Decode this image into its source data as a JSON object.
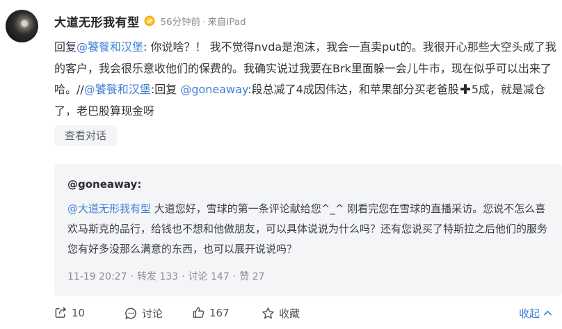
{
  "post": {
    "author": "大道无形我有型",
    "time": "56分钟前",
    "source": "来自iPad",
    "body": {
      "reply_prefix": "回复",
      "mention1": "@饕餮和汉堡",
      "seg1": ": 你说啥？！ 我不觉得nvda是泡沫，我会一直卖put的。我很开心那些大空头成了我的客户，我会很乐意收他们的保费的。我确实说过我要在Brk里面躲一会儿牛市，现在似乎可以出来了哈。//",
      "mention2": "@饕餮和汉堡",
      "seg2": ":回复",
      "mention3": "@goneaway",
      "seg3": ":段总减了4成因伟达，和苹果部分买老爸股",
      "seg4": "5成，就是减仓了，老巴股算现金呀"
    },
    "view_conversation": "查看对话"
  },
  "quoted": {
    "author": "@goneaway",
    "author_suffix": ":",
    "mention": "@大道无形我有型",
    "text": " 大道您好，雪球的第一条评论献给您^_^ 刚看完您在雪球的直播采访。您说不怎么喜欢马斯克的品行，给钱也不想和他做朋友，可以具体说说为什么吗？还有您说买了特斯拉之后他们的服务您有好多没那么满意的东西，也可以展开说说吗？",
    "date": "11-19 20:27",
    "reposts_label": "转发 133",
    "comments_label": "讨论 147",
    "likes_label": "赞 27"
  },
  "actions": {
    "repost_count": "10",
    "comment_label": "讨论",
    "like_count": "167",
    "favorite_label": "收藏",
    "collapse_label": "收起"
  },
  "icons": {
    "verified": "verified-badge-icon",
    "plus": "heavy-plus-emoji-icon",
    "repost": "share-arrow-icon",
    "comment": "chat-bubble-icon",
    "like": "thumbs-up-icon",
    "favorite": "star-icon",
    "collapse": "chevron-up-icon"
  },
  "colors": {
    "link": "#3e7fd6",
    "meta": "#8a8d94",
    "quote_bg": "#f4f5f7",
    "badge": "#f5b21d"
  }
}
